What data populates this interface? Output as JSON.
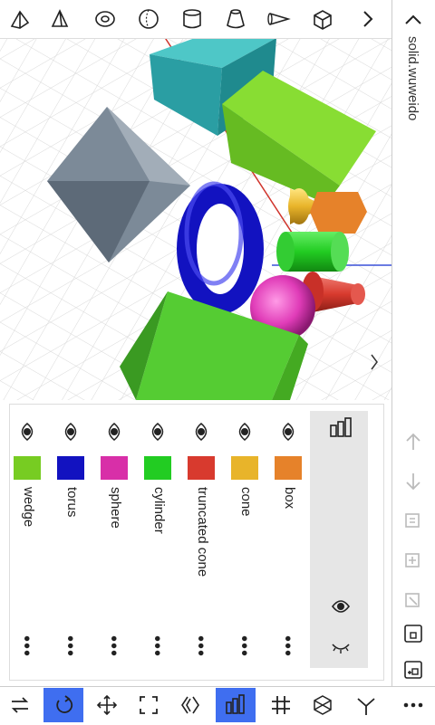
{
  "file": {
    "name": "solid.wuweido"
  },
  "toolbar": {
    "tools": [
      {
        "icon": "wedge-icon"
      },
      {
        "icon": "pyramid-icon"
      },
      {
        "icon": "torus-icon"
      },
      {
        "icon": "sphere-icon"
      },
      {
        "icon": "cylinder-icon"
      },
      {
        "icon": "truncated-cone-icon"
      },
      {
        "icon": "cone-icon"
      },
      {
        "icon": "box-icon"
      },
      {
        "icon": "chevron-right-icon"
      }
    ]
  },
  "objects": [
    {
      "name": "box",
      "color": "#e6822a",
      "visible": true
    },
    {
      "name": "cone",
      "color": "#e8b42a",
      "visible": true
    },
    {
      "name": "truncated cone",
      "color": "#d83a2e",
      "visible": true
    },
    {
      "name": "cylinder",
      "color": "#22cc22",
      "visible": true
    },
    {
      "name": "sphere",
      "color": "#d82fa8",
      "visible": true
    },
    {
      "name": "torus",
      "color": "#1212c0",
      "visible": true
    },
    {
      "name": "wedge",
      "color": "#77cc22",
      "visible": true
    }
  ],
  "bottom_tools": [
    {
      "icon": "swap-icon",
      "active": false
    },
    {
      "icon": "rotate-icon",
      "active": true
    },
    {
      "icon": "move-icon",
      "active": false
    },
    {
      "icon": "fit-view-icon",
      "active": false
    },
    {
      "icon": "perspective-icon",
      "active": false
    },
    {
      "icon": "object-list-icon",
      "active": true
    },
    {
      "icon": "grid-icon",
      "active": false
    },
    {
      "icon": "wireframe-icon",
      "active": false
    },
    {
      "icon": "axes-icon",
      "active": false
    },
    {
      "icon": "more-icon",
      "active": false
    }
  ],
  "colors": {
    "accent": "#3f6ef0",
    "x_axis": "#d0342c",
    "y_axis": "#3a50d8"
  }
}
